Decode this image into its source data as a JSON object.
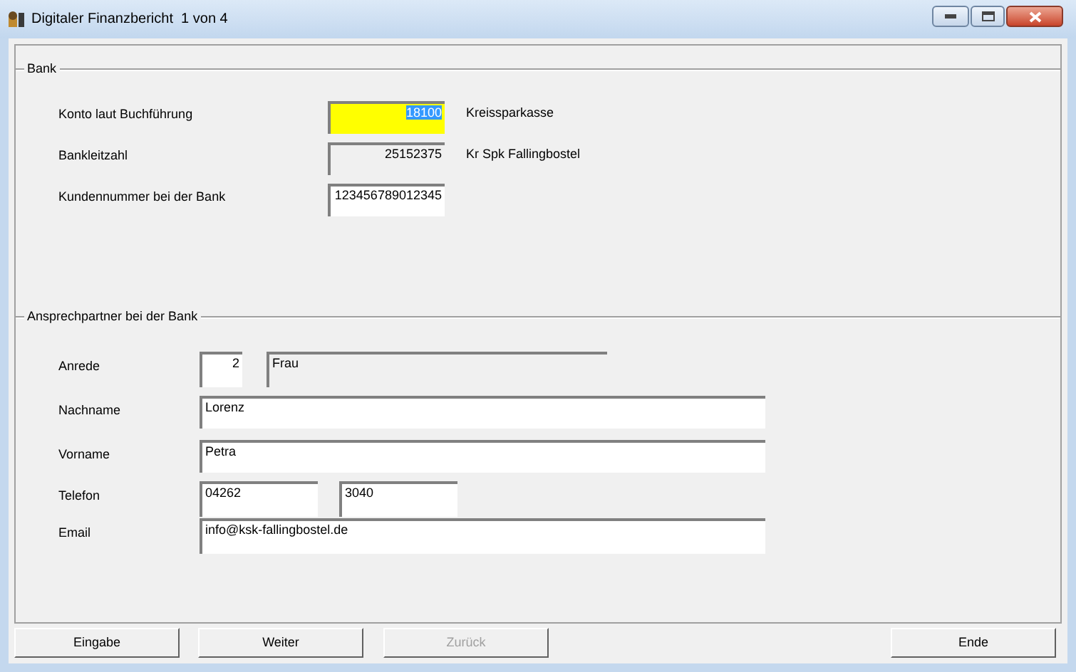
{
  "window": {
    "title": "Digitaler Finanzbericht  1 von 4"
  },
  "bank": {
    "legend": "Bank",
    "rows": [
      {
        "label": "Konto laut Buchführung",
        "value": "18100",
        "kind": "highlighted",
        "note": "Kreissparkasse"
      },
      {
        "label": "Bankleitzahl",
        "value": "25152375",
        "kind": "readonly",
        "note": "Kr Spk Fallingbostel"
      },
      {
        "label": "Kundennummer bei der Bank",
        "value": "123456789012345",
        "kind": "input"
      }
    ]
  },
  "contact": {
    "legend": "Ansprechpartner bei der Bank",
    "rows": [
      {
        "label": "Anrede",
        "fields": [
          {
            "value": "2",
            "kind": "input"
          },
          {
            "value": "Frau",
            "kind": "readonly"
          }
        ]
      },
      {
        "label": "Nachname",
        "fields": [
          {
            "value": "Lorenz",
            "kind": "input"
          }
        ]
      },
      {
        "label": "Vorname",
        "fields": [
          {
            "value": "Petra",
            "kind": "input"
          }
        ]
      },
      {
        "label": "Telefon",
        "fields": [
          {
            "value": "04262",
            "kind": "input"
          },
          {
            "value": "3040",
            "kind": "input"
          }
        ]
      },
      {
        "label": "Email",
        "fields": [
          {
            "value": "info@ksk-fallingbostel.de",
            "kind": "input"
          }
        ]
      }
    ]
  },
  "buttons": [
    {
      "label": "Eingabe",
      "disabled": false
    },
    {
      "label": "Weiter",
      "disabled": false
    },
    {
      "label": "Zurück",
      "disabled": true
    },
    {
      "label": "Ende",
      "disabled": false
    }
  ]
}
